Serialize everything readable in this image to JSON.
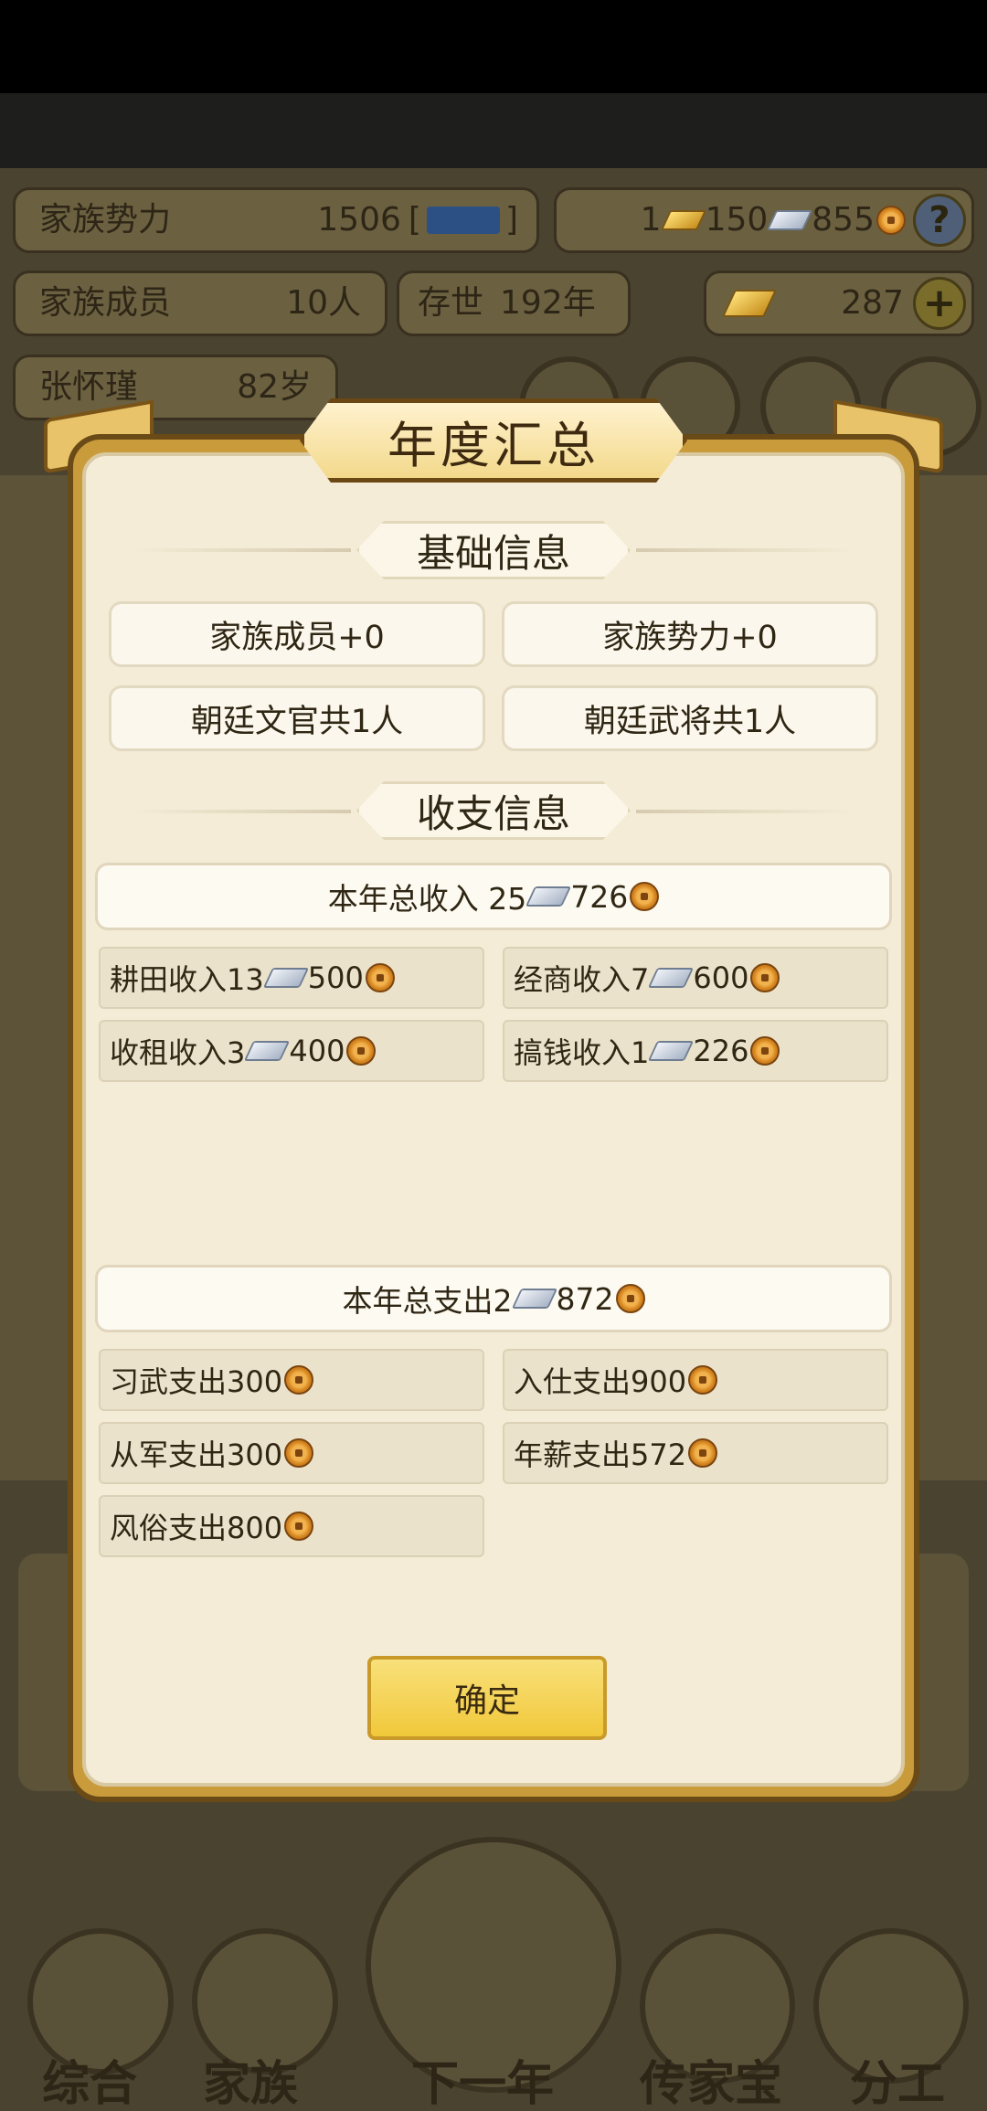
{
  "background": {
    "stats": {
      "power_label": "家族势力",
      "power_value": "1506",
      "power_suffix_open": "[",
      "power_suffix_close": "]",
      "currency_gold": "1",
      "currency_silver": "150",
      "currency_coin": "855",
      "help": "?",
      "members_label": "家族成员",
      "members_value": "10人",
      "exist_label": "存世",
      "exist_value": "192年",
      "ingot_value": "287",
      "plus": "+",
      "leader_name": "张怀瑾",
      "leader_age": "82岁"
    },
    "bottom_tabs": [
      "综合",
      "家族",
      "下一年",
      "传家宝",
      "分工"
    ]
  },
  "modal": {
    "title": "年度汇总",
    "basic_section": "基础信息",
    "basic_items": [
      "家族成员+0",
      "家族势力+0",
      "朝廷文官共1人",
      "朝廷武将共1人"
    ],
    "finance_section": "收支信息",
    "income_total": {
      "label": "本年总收入 25",
      "coin": "726"
    },
    "income_items": [
      {
        "label": "耕田收入13",
        "coin": "500"
      },
      {
        "label": "经商收入7",
        "coin": "600"
      },
      {
        "label": "收租收入3",
        "coin": "400"
      },
      {
        "label": "搞钱收入1",
        "coin": "226"
      }
    ],
    "expense_total": {
      "label": "本年总支出2",
      "coin": "872"
    },
    "expense_items": [
      {
        "label": "习武支出300"
      },
      {
        "label": "入仕支出900"
      },
      {
        "label": "从军支出300"
      },
      {
        "label": "年薪支出572"
      },
      {
        "label": "风俗支出800"
      }
    ],
    "confirm": "确定"
  }
}
